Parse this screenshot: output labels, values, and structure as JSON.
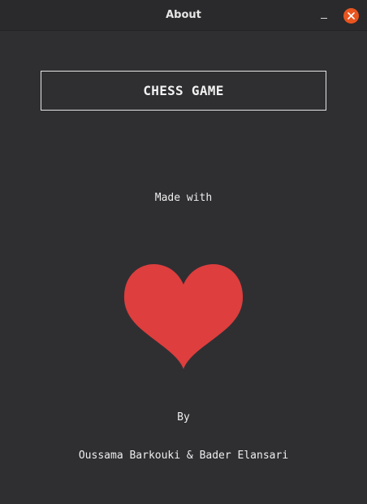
{
  "window": {
    "title": "About"
  },
  "content": {
    "app_title": "CHESS GAME",
    "made_with": "Made with",
    "heart_icon": "heart-icon",
    "by": "By",
    "authors": "Oussama Barkouki & Bader Elansari"
  },
  "colors": {
    "background": "#2f2f32",
    "heart": "#de3e3e",
    "close_button": "#e9541f",
    "text": "#eeeeee"
  }
}
